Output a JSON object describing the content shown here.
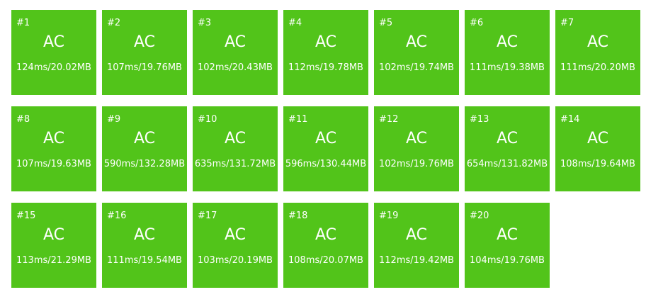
{
  "testcases": [
    {
      "id": "#1",
      "status": "AC",
      "stats": "124ms/20.02MB"
    },
    {
      "id": "#2",
      "status": "AC",
      "stats": "107ms/19.76MB"
    },
    {
      "id": "#3",
      "status": "AC",
      "stats": "102ms/20.43MB"
    },
    {
      "id": "#4",
      "status": "AC",
      "stats": "112ms/19.78MB"
    },
    {
      "id": "#5",
      "status": "AC",
      "stats": "102ms/19.74MB"
    },
    {
      "id": "#6",
      "status": "AC",
      "stats": "111ms/19.38MB"
    },
    {
      "id": "#7",
      "status": "AC",
      "stats": "111ms/20.20MB"
    },
    {
      "id": "#8",
      "status": "AC",
      "stats": "107ms/19.63MB"
    },
    {
      "id": "#9",
      "status": "AC",
      "stats": "590ms/132.28MB"
    },
    {
      "id": "#10",
      "status": "AC",
      "stats": "635ms/131.72MB"
    },
    {
      "id": "#11",
      "status": "AC",
      "stats": "596ms/130.44MB"
    },
    {
      "id": "#12",
      "status": "AC",
      "stats": "102ms/19.76MB"
    },
    {
      "id": "#13",
      "status": "AC",
      "stats": "654ms/131.82MB"
    },
    {
      "id": "#14",
      "status": "AC",
      "stats": "108ms/19.64MB"
    },
    {
      "id": "#15",
      "status": "AC",
      "stats": "113ms/21.29MB"
    },
    {
      "id": "#16",
      "status": "AC",
      "stats": "111ms/19.54MB"
    },
    {
      "id": "#17",
      "status": "AC",
      "stats": "103ms/20.19MB"
    },
    {
      "id": "#18",
      "status": "AC",
      "stats": "108ms/20.07MB"
    },
    {
      "id": "#19",
      "status": "AC",
      "stats": "112ms/19.42MB"
    },
    {
      "id": "#20",
      "status": "AC",
      "stats": "104ms/19.76MB"
    }
  ],
  "colors": {
    "accepted": "#52c41a",
    "text": "#ffffff"
  }
}
